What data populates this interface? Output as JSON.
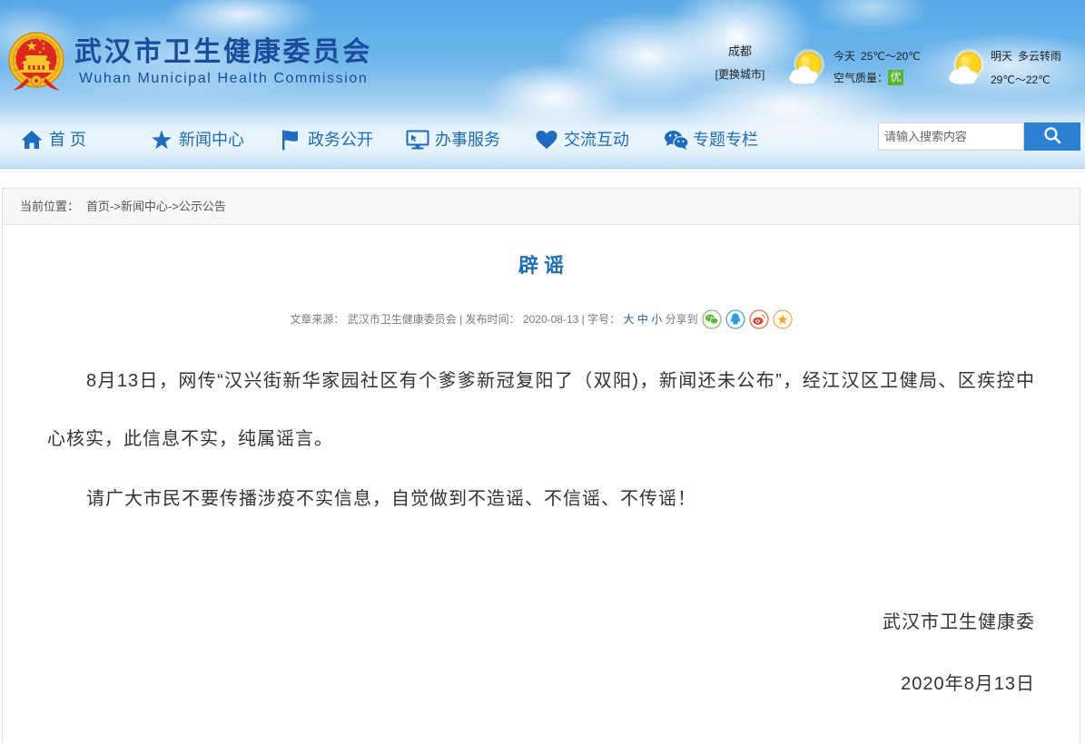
{
  "header": {
    "title_cn": "武汉市卫生健康委员会",
    "title_en": "Wuhan Municipal Health Commission",
    "logo_icon": "national-emblem-icon"
  },
  "colors": {
    "title": "#1b4c9c",
    "nav_text": "#1d6cbd",
    "article_title": "#1f6fb6",
    "link": "#1f5fb0",
    "air_good_badge": "#5bb432",
    "search_button": "#2b82d3"
  },
  "weather": {
    "city": "成都",
    "change_city": "[更换城市]",
    "today_icon": "sun-cloud-icon",
    "today_label": "今天",
    "today_temp": "25℃～20℃",
    "air_label": "空气质量：",
    "air_value": "优",
    "tomorrow_icon": "sun-cloud-icon",
    "tomorrow_label": "明天",
    "tomorrow_desc": "多云转雨",
    "tomorrow_temp": "29℃～22℃"
  },
  "nav": [
    {
      "label": "首 页",
      "icon": "home-icon"
    },
    {
      "label": "新闻中心",
      "icon": "star-icon"
    },
    {
      "label": "政务公开",
      "icon": "flag-icon"
    },
    {
      "label": "办事服务",
      "icon": "monitor-icon"
    },
    {
      "label": "交流互动",
      "icon": "heart-icon"
    },
    {
      "label": "专题专栏",
      "icon": "chat-bubbles-icon"
    }
  ],
  "search": {
    "placeholder": "请输入搜索内容",
    "icon": "search-icon"
  },
  "breadcrumb": {
    "label": "当前位置：",
    "items": [
      "首页",
      "新闻中心",
      "公示公告"
    ],
    "separator": "->"
  },
  "article": {
    "title": "辟 谣",
    "meta": {
      "source_label": "文章来源：",
      "source": "武汉市卫生健康委员会",
      "separator": "|",
      "date_label": "发布时间：",
      "date": "2020-08-13",
      "font_size_label": "字号：",
      "font_sizes": [
        "大",
        "中",
        "小"
      ],
      "share_label": "分享到",
      "share_targets": [
        "wechat-icon",
        "qq-icon",
        "weibo-icon",
        "favorite-star-icon"
      ]
    },
    "paragraphs": [
      "8月13日，网传“汉兴街新华家园社区有个爹爹新冠复阳了（双阳)，新闻还未公布”，经江汉区卫健局、区疾控中心核实，此信息不实，纯属谣言。",
      "请广大市民不要传播涉疫不实信息，自觉做到不造谣、不信谣、不传谣！"
    ],
    "signature": "武汉市卫生健康委",
    "signature_date": "2020年8月13日"
  }
}
